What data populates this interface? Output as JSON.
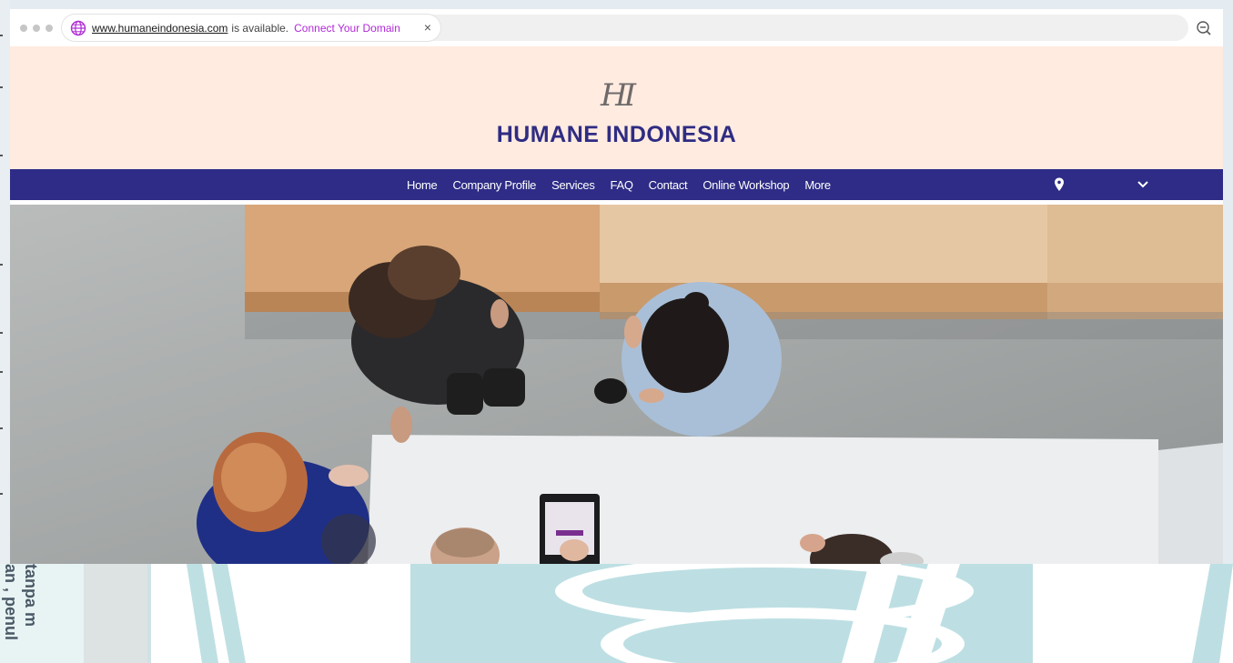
{
  "browser": {
    "domain_link": "www.humaneindonesia.com",
    "availability_text": "is available.",
    "connect_label": "Connect Your Domain",
    "close_label": "×"
  },
  "site": {
    "logo_mark": "HI",
    "title": "HUMANE INDONESIA"
  },
  "nav": {
    "items": [
      {
        "label": "Home"
      },
      {
        "label": "Company Profile"
      },
      {
        "label": "Services"
      },
      {
        "label": "FAQ"
      },
      {
        "label": "Contact"
      },
      {
        "label": "Online Workshop"
      },
      {
        "label": "More"
      }
    ],
    "location_icon": "map-pin-icon",
    "dropdown_icon": "chevron-down-icon"
  },
  "hero": {
    "image": "overhead-office-meeting-photo"
  },
  "watermark": {
    "line1": "tanpa m",
    "line2": "an , penul"
  },
  "colors": {
    "header_bg": "#ffebe0",
    "nav_bg": "#2e2c86",
    "title_color": "#2f2c83",
    "connect_color": "#b02ad6"
  }
}
